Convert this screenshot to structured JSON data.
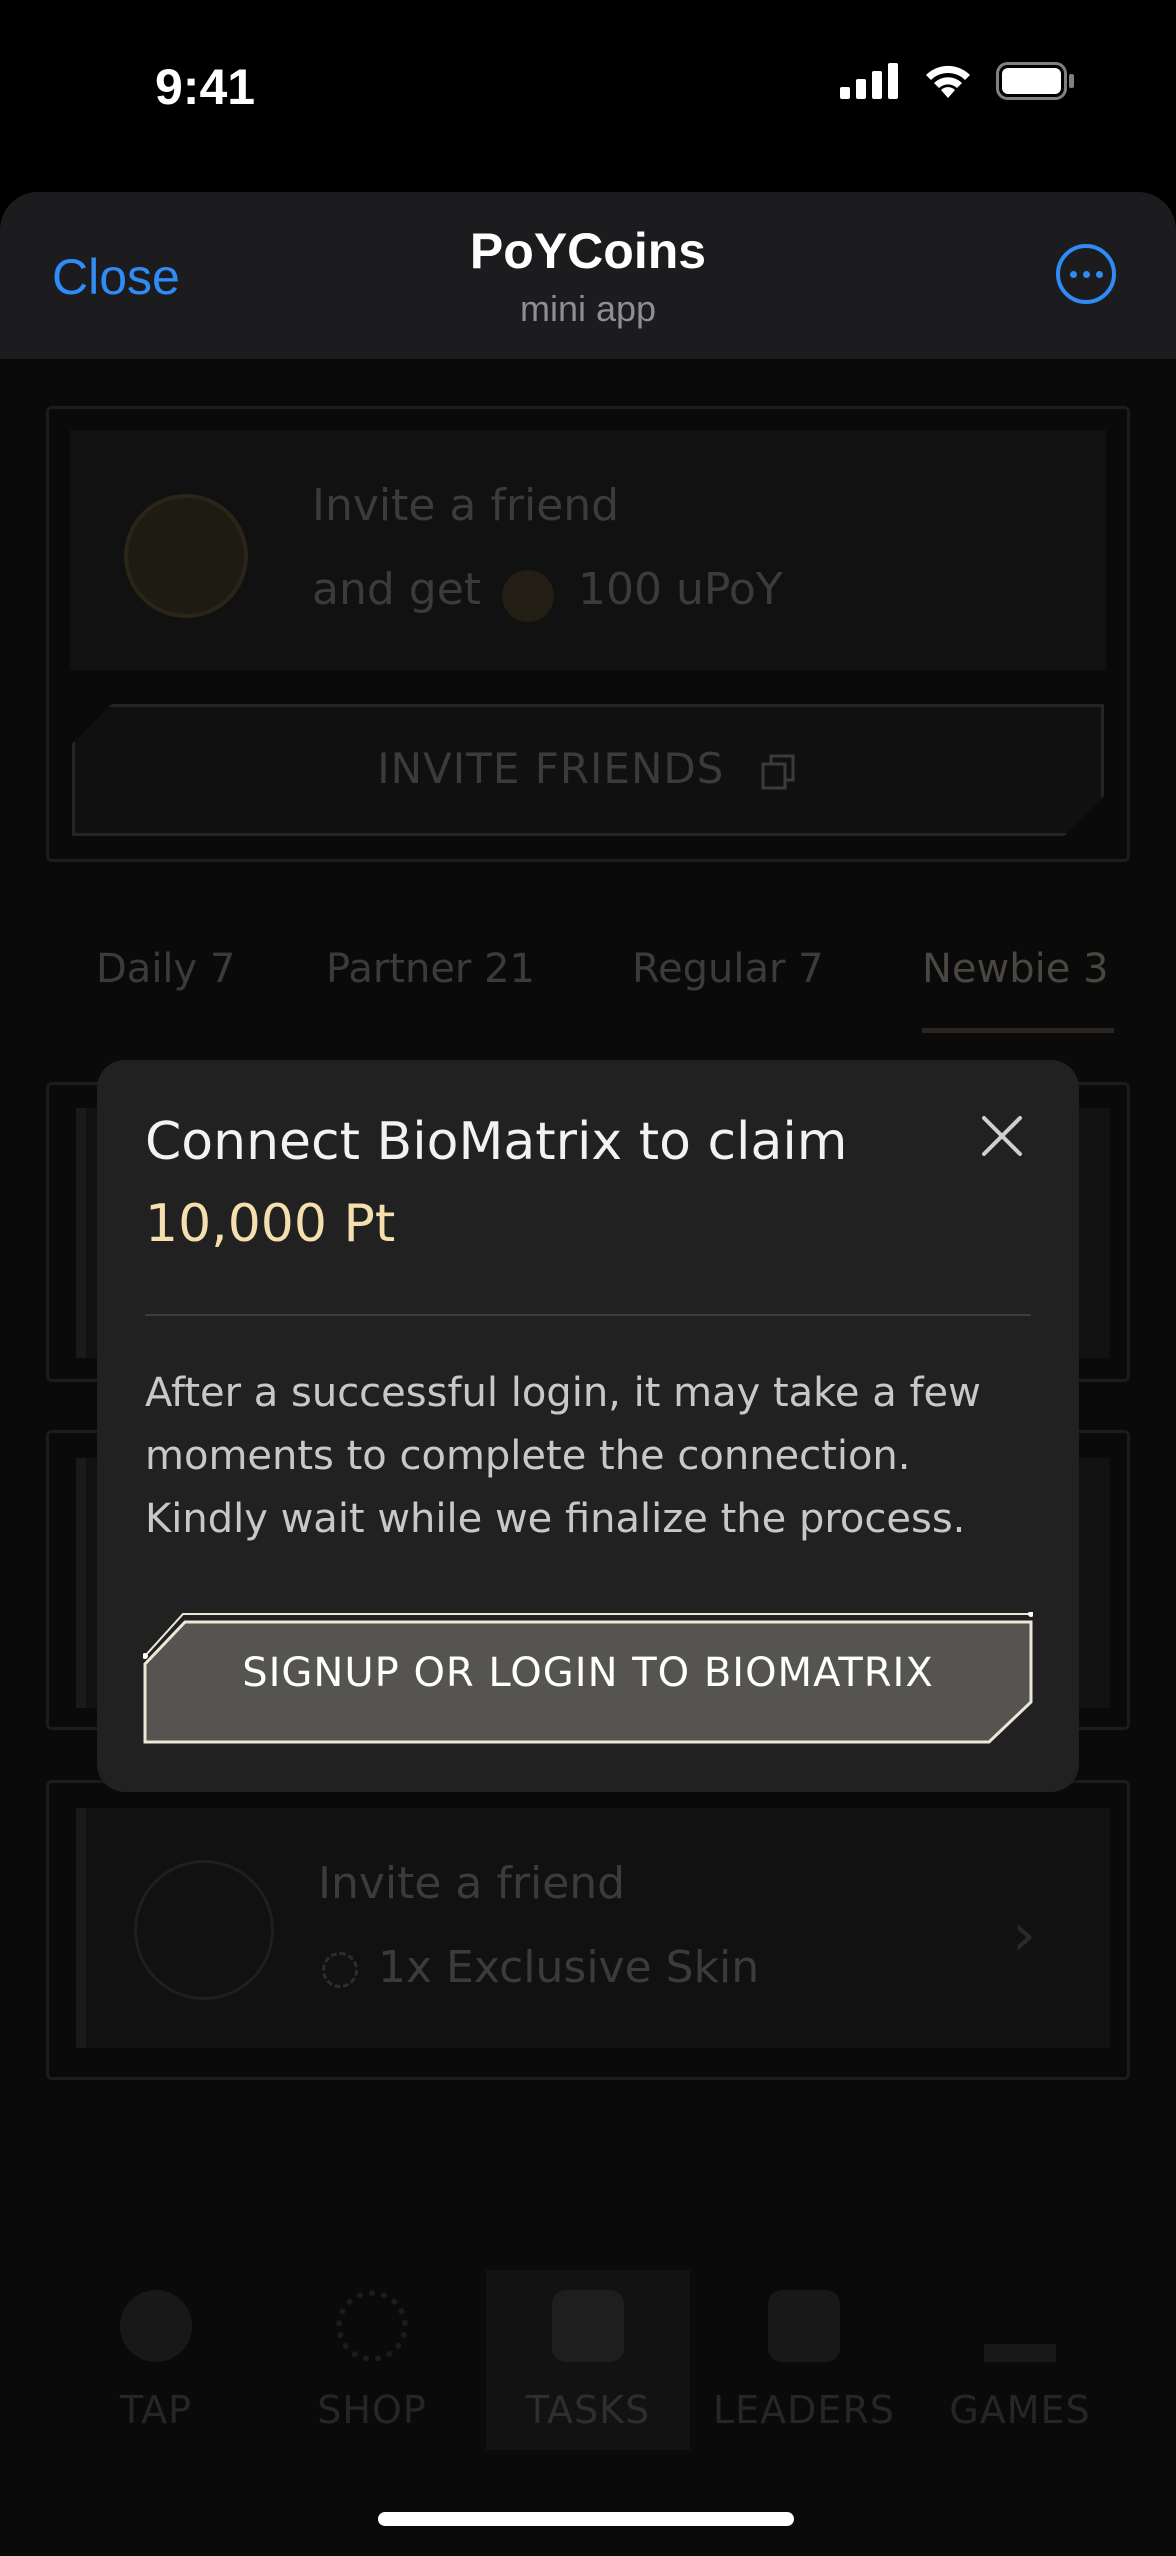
{
  "status_bar": {
    "time": "9:41"
  },
  "header": {
    "close_label": "Close",
    "title": "PoYCoins",
    "subtitle": "mini app"
  },
  "invite_card": {
    "title": "Invite a friend",
    "reward_prefix": "and get",
    "reward_amount": "100 uPoY",
    "button_label": "INVITE FRIENDS"
  },
  "tabs": [
    {
      "label": "Daily 7"
    },
    {
      "label": "Partner 21"
    },
    {
      "label": "Regular 7"
    },
    {
      "label": "Newbie 3"
    }
  ],
  "tasks": [
    {
      "title": "Invite a friend",
      "reward": "1x Exclusive Skin"
    }
  ],
  "bottom_nav": [
    {
      "label": "TAP"
    },
    {
      "label": "SHOP"
    },
    {
      "label": "TASKS"
    },
    {
      "label": "LEADERS"
    },
    {
      "label": "GAMES"
    }
  ],
  "modal": {
    "title": "Connect BioMatrix to claim",
    "amount": "10,000 Pt",
    "description": "After a successful login, it may take a few moments to complete the connection. Kindly wait while we finalize the process.",
    "button_label": "SIGNUP OR LOGIN TO BIOMATRIX"
  },
  "colors": {
    "accent_blue": "#2f8bf5",
    "amount_gold": "#f5dfae",
    "modal_bg": "#212121",
    "button_fill": "#555450"
  }
}
